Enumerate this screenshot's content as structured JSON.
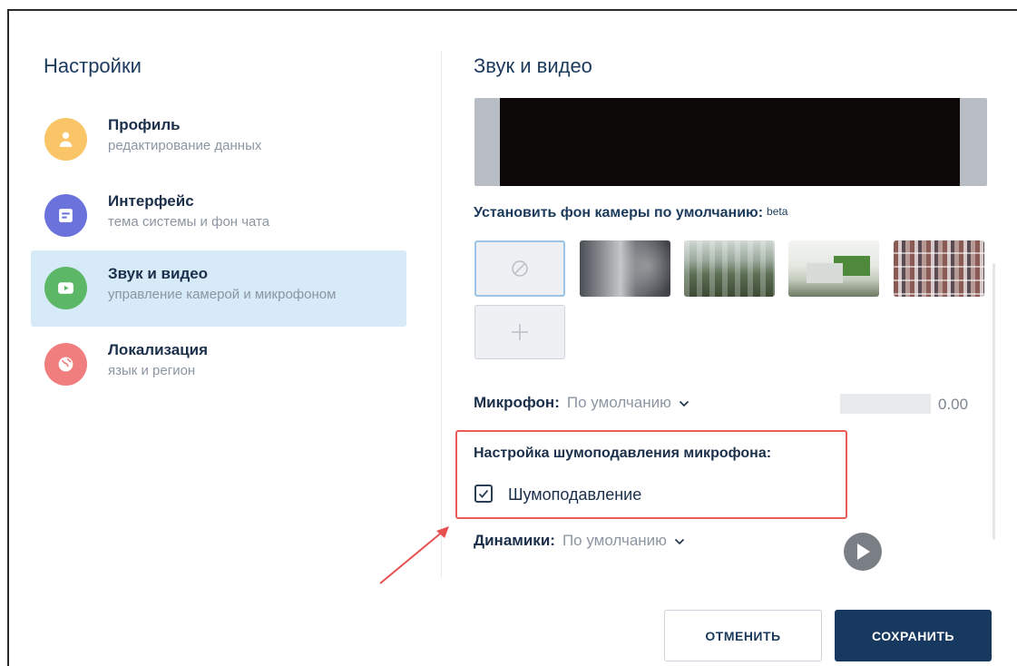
{
  "sidebar": {
    "title": "Настройки",
    "items": [
      {
        "label": "Профиль",
        "sub": "редактирование данных",
        "icon": "user-icon",
        "color": "#f9c566"
      },
      {
        "label": "Интерфейс",
        "sub": "тема системы и фон чата",
        "icon": "interface-icon",
        "color": "#6b72dc"
      },
      {
        "label": "Звук и видео",
        "sub": "управление камерой и микрофоном",
        "icon": "video-icon",
        "color": "#5cb866",
        "active": true
      },
      {
        "label": "Локализация",
        "sub": "язык и регион",
        "icon": "globe-icon",
        "color": "#f07e7e"
      }
    ]
  },
  "main": {
    "title": "Звук и видео",
    "camera_bg_label": "Установить фон камеры по умолчанию:",
    "beta": "beta",
    "microphone": {
      "label": "Микрофон:",
      "value": "По умолчанию",
      "level": "0.00"
    },
    "noise": {
      "title": "Настройка шумоподавления микрофона:",
      "checkbox_label": "Шумоподавление",
      "checked": true
    },
    "speakers": {
      "label": "Динамики:",
      "value": "По умолчанию"
    }
  },
  "buttons": {
    "cancel": "ОТМЕНИТЬ",
    "save": "СОХРАНИТЬ"
  },
  "colors": {
    "accent": "#17395f",
    "active_bg": "#d7eaf8",
    "highlight": "#e85c5c"
  }
}
